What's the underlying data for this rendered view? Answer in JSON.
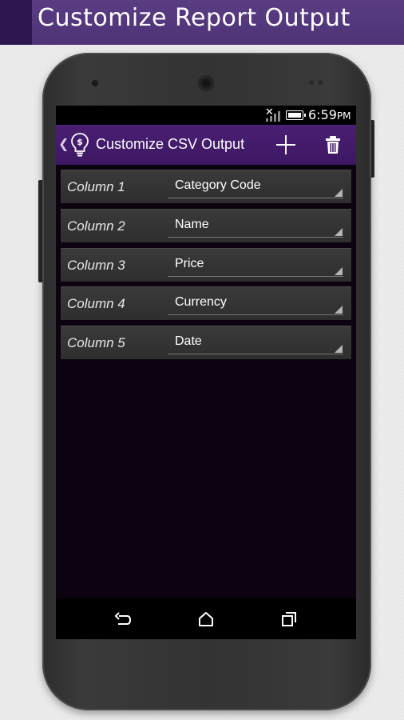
{
  "banner": {
    "title": "Customize Report Output"
  },
  "status_bar": {
    "time": "6:59",
    "ampm": "PM"
  },
  "action_bar": {
    "title": "Customize CSV Output",
    "add_icon": "plus-icon",
    "delete_icon": "trash-icon"
  },
  "columns": [
    {
      "label": "Column 1",
      "value": "Category Code"
    },
    {
      "label": "Column 2",
      "value": "Name"
    },
    {
      "label": "Column 3",
      "value": "Price"
    },
    {
      "label": "Column 4",
      "value": "Currency"
    },
    {
      "label": "Column 5",
      "value": "Date"
    }
  ],
  "nav_bar": {
    "back_icon": "back-icon",
    "home_icon": "home-icon",
    "recents_icon": "recents-icon"
  },
  "colors": {
    "banner": "#553a7e",
    "action_bar": "#441b6c",
    "screen_bg": "#0c0210",
    "row_bg": "#333333"
  }
}
